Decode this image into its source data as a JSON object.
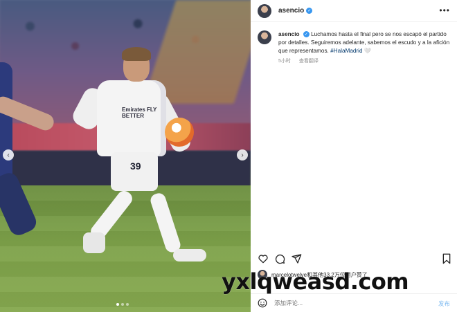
{
  "post": {
    "username": "asencio",
    "more_icon": "more-horizontal-icon",
    "caption": {
      "username": "asencio",
      "text": "Luchamos hasta el final pero se nos escapó el partido por detalles. Seguiremos adelante, sabemos el escudo y a la afición que representamos.",
      "hashtag": "#HalaMadrid",
      "emoji": "🤍"
    },
    "time_ago": "5小时",
    "translate_label": "查看翻译"
  },
  "media": {
    "shirt_sponsor": "Emirates FLY BETTER",
    "shirt_number": "39",
    "carousel_dots": 3,
    "active_dot": 0
  },
  "actions": {
    "like_icon": "heart-icon",
    "comment_icon": "comment-icon",
    "share_icon": "send-icon",
    "save_icon": "bookmark-icon"
  },
  "likes": {
    "text": "marcelotwelve和其他33.2万位用户赞了"
  },
  "comment_box": {
    "placeholder": "添加评论...",
    "post_label": "发布"
  },
  "watermark": "yxlqweasd.com",
  "colors": {
    "verified": "#3897f0",
    "hashtag": "#00376b",
    "post_button": "#7ab8f0",
    "muted_text": "#8e8e8e"
  }
}
